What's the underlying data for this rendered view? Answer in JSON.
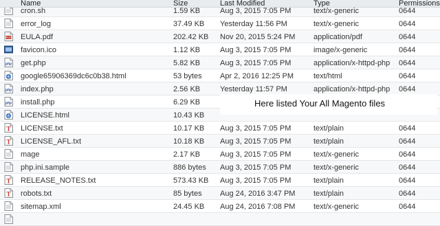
{
  "header": {
    "name": "Name",
    "size": "Size",
    "last_modified": "Last Modified",
    "type": "Type",
    "permissions": "Permissions"
  },
  "overlay_text": "Here listed Your All Magento files",
  "files": [
    {
      "name": "cron.sh",
      "size": "1.59 KB",
      "modified": "Aug 3, 2015 7:05 PM",
      "type": "text/x-generic",
      "perm": "0644",
      "icon": "generic-file-icon"
    },
    {
      "name": "error_log",
      "size": "37.49 KB",
      "modified": "Yesterday 11:56 PM",
      "type": "text/x-generic",
      "perm": "0644",
      "icon": "generic-file-icon"
    },
    {
      "name": "EULA.pdf",
      "size": "202.42 KB",
      "modified": "Nov 20, 2015 5:24 PM",
      "type": "application/pdf",
      "perm": "0644",
      "icon": "pdf-file-icon"
    },
    {
      "name": "favicon.ico",
      "size": "1.12 KB",
      "modified": "Aug 3, 2015 7:05 PM",
      "type": "image/x-generic",
      "perm": "0644",
      "icon": "image-file-icon"
    },
    {
      "name": "get.php",
      "size": "5.82 KB",
      "modified": "Aug 3, 2015 7:05 PM",
      "type": "application/x-httpd-php",
      "perm": "0644",
      "icon": "php-file-icon"
    },
    {
      "name": "google65906369dc6c0b38.html",
      "size": "53 bytes",
      "modified": "Apr 2, 2016 12:25 PM",
      "type": "text/html",
      "perm": "0644",
      "icon": "html-file-icon"
    },
    {
      "name": "index.php",
      "size": "2.56 KB",
      "modified": "Yesterday 11:57 PM",
      "type": "application/x-httpd-php",
      "perm": "0644",
      "icon": "php-file-icon"
    },
    {
      "name": "install.php",
      "size": "6.29 KB",
      "modified": "",
      "type": "",
      "perm": "",
      "icon": "php-file-icon"
    },
    {
      "name": "LICENSE.html",
      "size": "10.43 KB",
      "modified": "",
      "type": "",
      "perm": "",
      "icon": "html-file-icon"
    },
    {
      "name": "LICENSE.txt",
      "size": "10.17 KB",
      "modified": "Aug 3, 2015 7:05 PM",
      "type": "text/plain",
      "perm": "0644",
      "icon": "text-file-icon"
    },
    {
      "name": "LICENSE_AFL.txt",
      "size": "10.18 KB",
      "modified": "Aug 3, 2015 7:05 PM",
      "type": "text/plain",
      "perm": "0644",
      "icon": "text-file-icon"
    },
    {
      "name": "mage",
      "size": "2.17 KB",
      "modified": "Aug 3, 2015 7:05 PM",
      "type": "text/x-generic",
      "perm": "0644",
      "icon": "generic-file-icon"
    },
    {
      "name": "php.ini.sample",
      "size": "886 bytes",
      "modified": "Aug 3, 2015 7:05 PM",
      "type": "text/x-generic",
      "perm": "0644",
      "icon": "generic-file-icon"
    },
    {
      "name": "RELEASE_NOTES.txt",
      "size": "573.43 KB",
      "modified": "Aug 3, 2015 7:05 PM",
      "type": "text/plain",
      "perm": "0644",
      "icon": "text-file-icon"
    },
    {
      "name": "robots.txt",
      "size": "85 bytes",
      "modified": "Aug 24, 2016 3:47 PM",
      "type": "text/plain",
      "perm": "0644",
      "icon": "text-file-icon"
    },
    {
      "name": "sitemap.xml",
      "size": "24.45 KB",
      "modified": "Aug 24, 2016 7:08 PM",
      "type": "text/x-generic",
      "perm": "0644",
      "icon": "generic-file-icon"
    },
    {
      "name": "",
      "size": "",
      "modified": "",
      "type": "",
      "perm": "",
      "icon": "generic-file-icon"
    }
  ]
}
